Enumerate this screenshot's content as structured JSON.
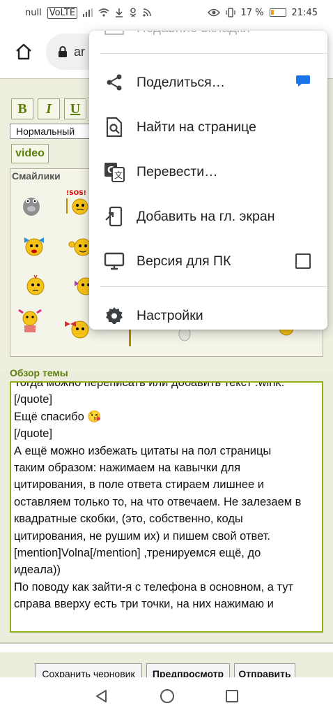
{
  "status_bar": {
    "left_text": "null",
    "volte": "VoLTE",
    "battery": "17 %",
    "time": "21:45"
  },
  "browser": {
    "url_fragment": "ar"
  },
  "editor": {
    "bold_label": "B",
    "italic_label": "I",
    "underline_label": "U",
    "font_size_value": "Нормальный",
    "video_label": "video",
    "smiles_title": "Смайлики",
    "review_title": "Обзор темы",
    "text_lines": [
      "Тогда можно переписать или добавить текст :wink:",
      "[/quote]",
      "Ещё спасибо 😘",
      "[/quote]",
      "А ещё можно избежать цитаты на пол страницы",
      "таким образом: нажимаем на кавычки для",
      "цитирования, в поле ответа стираем лишнее и",
      "оставляем только то, на что отвечаем. Не залезаем в",
      "квадратные скобки, (это, собственно, коды",
      "цитирования, не рушим их) и пишем свой ответ.",
      "[mention]Volna[/mention] ,тренируемся ещё, до",
      "идеала))",
      "По поводу как зайти-я с телефона в основном, а тут",
      "справа вверху есть три точки, на них нажимаю и"
    ]
  },
  "actions": {
    "save_draft": "Сохранить черновик",
    "preview": "Предпросмотр",
    "submit": "Отправить"
  },
  "menu": {
    "faded_item": "Недавние вкладки",
    "items": [
      {
        "label": "Поделиться…",
        "icon": "share-icon"
      },
      {
        "label": "Найти на странице",
        "icon": "find-in-page-icon"
      },
      {
        "label": "Перевести…",
        "icon": "translate-icon"
      },
      {
        "label": "Добавить на гл. экран",
        "icon": "add-to-home-icon"
      },
      {
        "label": "Версия для ПК",
        "icon": "desktop-icon"
      },
      {
        "label": "Настройки",
        "icon": "settings-icon"
      }
    ]
  },
  "colors": {
    "accent_green": "#5b7f0a",
    "textarea_border": "#8fb21a",
    "page_bg": "#ededde"
  }
}
